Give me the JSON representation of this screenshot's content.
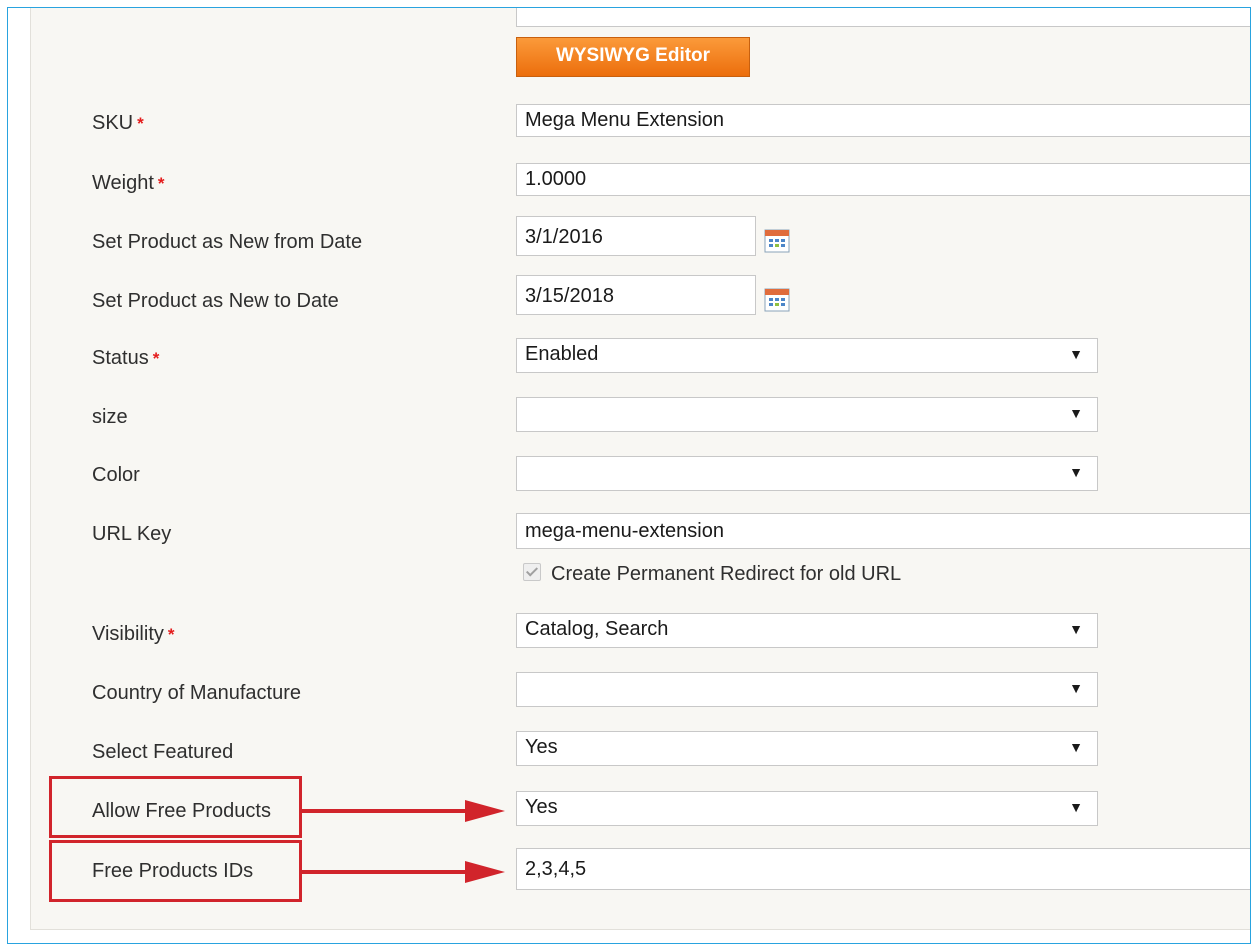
{
  "editor": {
    "wysiwyg_label": "WYSIWYG Editor"
  },
  "required_marker": "*",
  "fields": {
    "sku": {
      "label": "SKU",
      "value": "Mega Menu Extension"
    },
    "weight": {
      "label": "Weight",
      "value": "1.0000"
    },
    "new_from": {
      "label": "Set Product as New from Date",
      "value": "3/1/2016"
    },
    "new_to": {
      "label": "Set Product as New to Date",
      "value": "3/15/2018"
    },
    "status": {
      "label": "Status",
      "value": "Enabled"
    },
    "size": {
      "label": "size",
      "value": ""
    },
    "color": {
      "label": "Color",
      "value": ""
    },
    "url_key": {
      "label": "URL Key",
      "value": "mega-menu-extension",
      "redirect_label": "Create Permanent Redirect for old URL",
      "redirect_checked": true
    },
    "visibility": {
      "label": "Visibility",
      "value": "Catalog, Search"
    },
    "country": {
      "label": "Country of Manufacture",
      "value": ""
    },
    "featured": {
      "label": "Select Featured",
      "value": "Yes"
    },
    "allow_free": {
      "label": "Allow Free Products",
      "value": "Yes"
    },
    "free_ids": {
      "label": "Free Products IDs",
      "value": "2,3,4,5"
    }
  },
  "icons": {
    "select_arrow": "▼",
    "calendar": "calendar-icon"
  },
  "colors": {
    "accent_button": "#ec6e0c",
    "required": "#e41b1b",
    "highlight": "#d1242b",
    "frame": "#29a3df"
  }
}
